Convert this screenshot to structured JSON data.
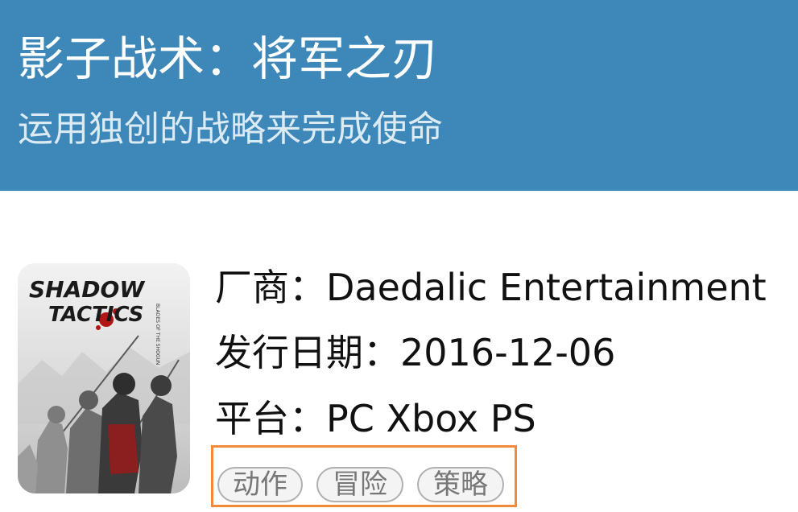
{
  "header": {
    "title": "影子战术：将军之刃",
    "subtitle": "运用独创的战略来完成使命",
    "background_color": "#3d88b9"
  },
  "cover": {
    "logo_line1": "SHADOW",
    "logo_line2": "TACTICS",
    "logo_tagline": "BLADES OF THE SHOGUN"
  },
  "info": {
    "vendor": "厂商：Daedalic Entertainment",
    "release_date": "发行日期：2016-12-06",
    "platforms": "平台：PC Xbox PS"
  },
  "tags": [
    "动作",
    "冒险",
    "策略"
  ],
  "highlight_color": "#f28a3a"
}
